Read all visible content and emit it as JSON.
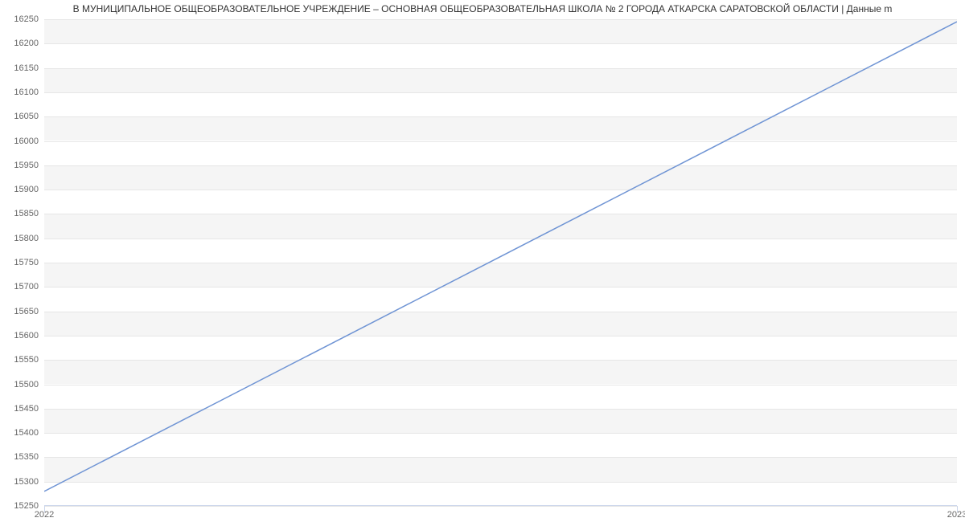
{
  "chart_data": {
    "type": "line",
    "title": "В МУНИЦИПАЛЬНОЕ ОБЩЕОБРАЗОВАТЕЛЬНОЕ УЧРЕЖДЕНИЕ – ОСНОВНАЯ ОБЩЕОБРАЗОВАТЕЛЬНАЯ ШКОЛА № 2 ГОРОДА АТКАРСКА САРАТОВСКОЙ ОБЛАСТИ | Данные m",
    "x": [
      2022,
      2023
    ],
    "values": [
      15280,
      16245
    ],
    "xlabel": "",
    "ylabel": "",
    "ylim": [
      15250,
      16250
    ],
    "y_ticks": [
      15250,
      15300,
      15350,
      15400,
      15450,
      15500,
      15550,
      15600,
      15650,
      15700,
      15750,
      15800,
      15850,
      15900,
      15950,
      16000,
      16050,
      16100,
      16150,
      16200,
      16250
    ],
    "x_ticks": [
      2022,
      2023
    ],
    "line_color": "#6f94d4"
  }
}
